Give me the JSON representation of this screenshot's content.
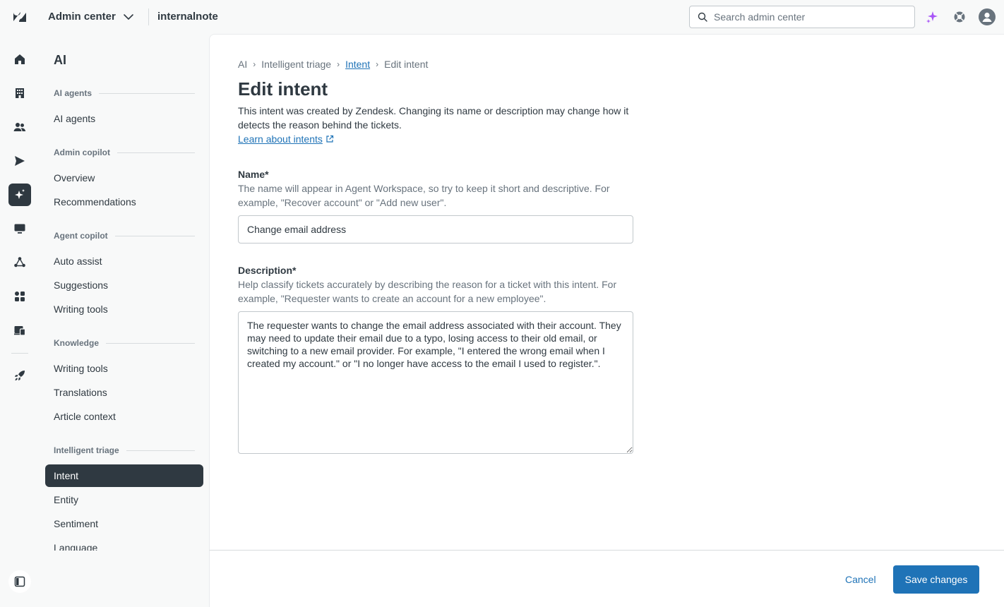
{
  "topbar": {
    "app_name": "Admin center",
    "subdomain": "internalnote",
    "search_placeholder": "Search admin center"
  },
  "sidebar": {
    "title": "AI",
    "sections": [
      {
        "heading": "AI agents",
        "items": [
          "AI agents"
        ]
      },
      {
        "heading": "Admin copilot",
        "items": [
          "Overview",
          "Recommendations"
        ]
      },
      {
        "heading": "Agent copilot",
        "items": [
          "Auto assist",
          "Suggestions",
          "Writing tools"
        ]
      },
      {
        "heading": "Knowledge",
        "items": [
          "Writing tools",
          "Translations",
          "Article context"
        ]
      },
      {
        "heading": "Intelligent triage",
        "items": [
          "Intent",
          "Entity",
          "Sentiment",
          "Language"
        ]
      }
    ],
    "active_item": "Intent"
  },
  "breadcrumb": {
    "items": [
      "AI",
      "Intelligent triage",
      "Intent",
      "Edit intent"
    ]
  },
  "page": {
    "title": "Edit intent",
    "intro": "This intent was created by Zendesk. Changing its name or description may change how it detects the reason behind the tickets.",
    "learn_link": "Learn about intents"
  },
  "form": {
    "name_label": "Name*",
    "name_hint": "The name will appear in Agent Workspace, so try to keep it short and descriptive. For example, \"Recover account\" or \"Add new user\".",
    "name_value": "Change email address",
    "description_label": "Description*",
    "description_hint": "Help classify tickets accurately by describing the reason for a ticket with this intent. For example, \"Requester wants to create an account for a new employee\".",
    "description_value": "The requester wants to change the email address associated with their account. They may need to update their email due to a typo, losing access to their old email, or switching to a new email provider. For example, \"I entered the wrong email when I created my account.\" or \"I no longer have access to the email I used to register.\"."
  },
  "footer": {
    "cancel_label": "Cancel",
    "save_label": "Save changes"
  },
  "colors": {
    "accent": "#1f73b7",
    "active_nav": "#2f3941",
    "ai_sparkle": "#a855f7"
  }
}
